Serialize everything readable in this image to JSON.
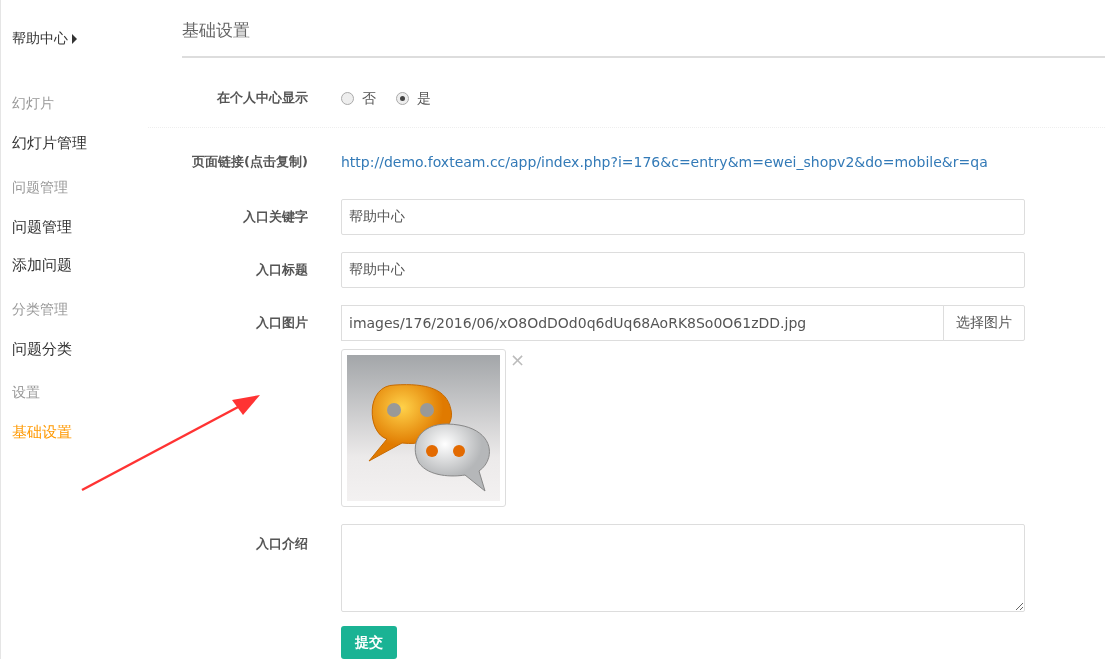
{
  "sidebar": {
    "header": "帮助中心",
    "groups": [
      {
        "title": "幻灯片",
        "items": [
          {
            "label": "幻灯片管理",
            "selected": false
          }
        ]
      },
      {
        "title": "问题管理",
        "items": [
          {
            "label": "问题管理",
            "selected": false
          },
          {
            "label": "添加问题",
            "selected": false
          }
        ]
      },
      {
        "title": "分类管理",
        "items": [
          {
            "label": "问题分类",
            "selected": false
          }
        ]
      },
      {
        "title": "设置",
        "items": [
          {
            "label": "基础设置",
            "selected": true
          }
        ]
      }
    ]
  },
  "page_title": "基础设置",
  "fields": [
    {
      "kind": "radio",
      "label": "在个人中心显示",
      "options": [
        {
          "label": "否",
          "selected": false
        },
        {
          "label": "是",
          "selected": true
        }
      ]
    },
    {
      "kind": "link",
      "label": "页面链接(点击复制)",
      "value": "http://demo.foxteam.cc/app/index.php?i=176&c=entry&m=ewei_shopv2&do=mobile&r=qa"
    },
    {
      "kind": "text",
      "label": "入口关键字",
      "value": "帮助中心"
    },
    {
      "kind": "text",
      "label": "入口标题",
      "value": "帮助中心"
    },
    {
      "kind": "image",
      "label": "入口图片",
      "value": "images/176/2016/06/xO8OdDOd0q6dUq68AoRK8So0O61zDD.jpg",
      "button": "选择图片",
      "remove": "×"
    },
    {
      "kind": "textarea",
      "label": "入口介绍"
    }
  ],
  "submit": "提交"
}
